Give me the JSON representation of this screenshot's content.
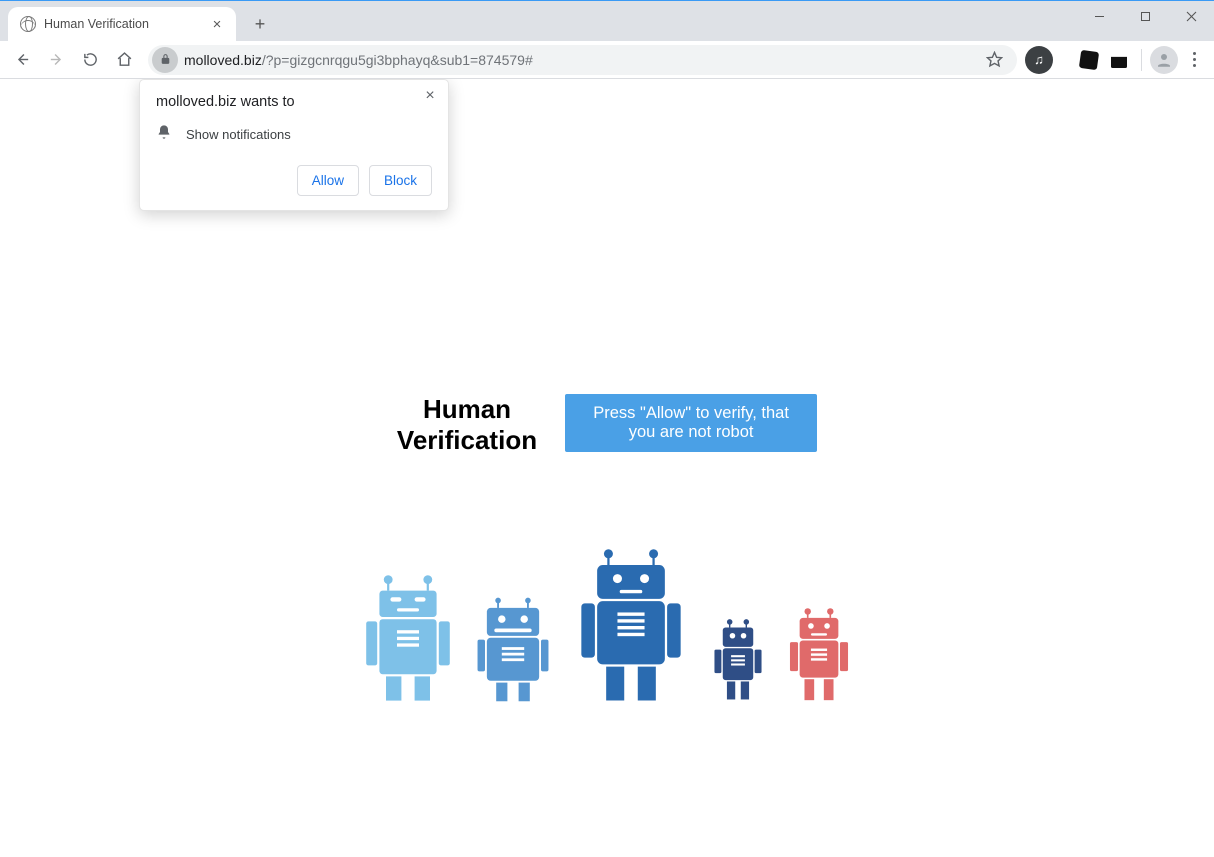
{
  "tab": {
    "title": "Human Verification"
  },
  "url": {
    "host": "molloved.biz",
    "rest": "/?p=gizgcnrqgu5gi3bphayq&sub1=874579#"
  },
  "permission": {
    "heading": "molloved.biz wants to",
    "item": "Show notifications",
    "allow": "Allow",
    "block": "Block"
  },
  "page": {
    "heading_line1": "Human",
    "heading_line2": "Verification",
    "banner": "Press \"Allow\" to verify, that you are not robot"
  }
}
